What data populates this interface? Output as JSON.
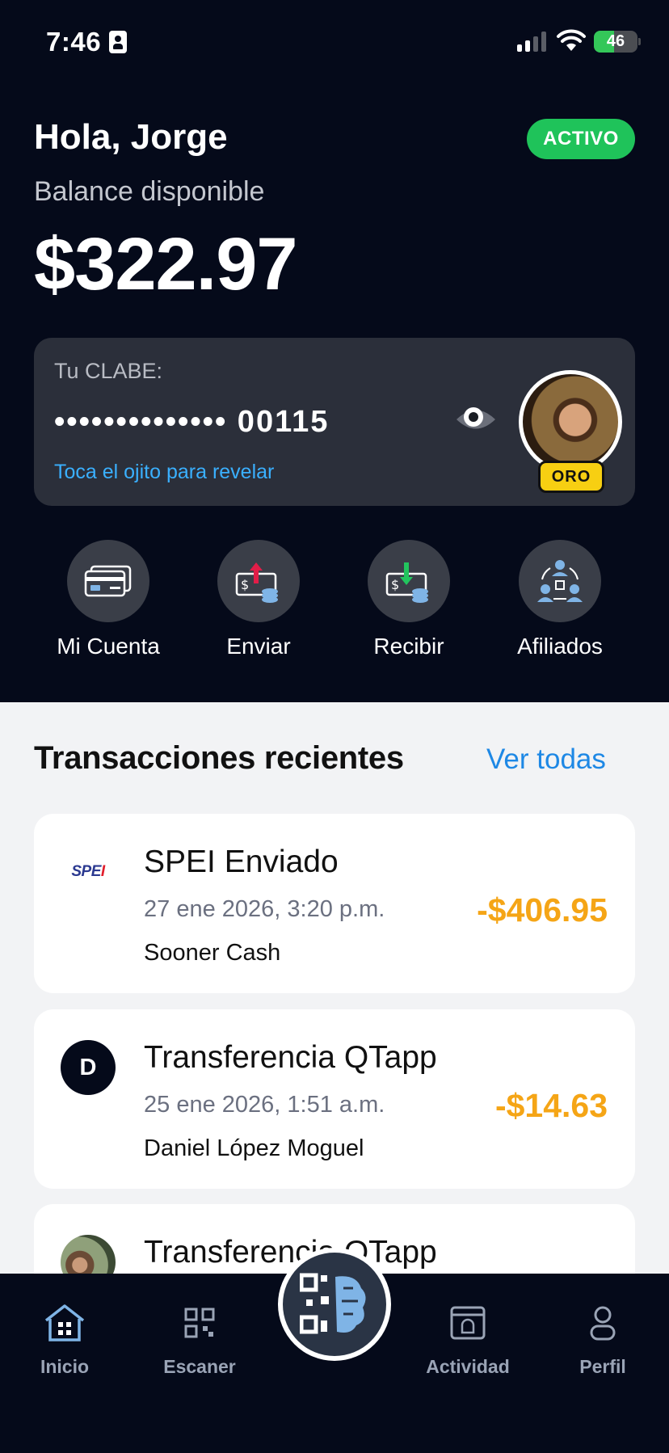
{
  "status_bar": {
    "time": "7:46",
    "battery": "46",
    "battery_percent": 46
  },
  "header": {
    "greeting": "Hola, Jorge",
    "status_badge": "ACTIVO",
    "balance_label": "Balance disponible",
    "balance": "$322.97"
  },
  "clabe": {
    "label": "Tu CLABE:",
    "masked_number": "•••••••••••••• 00115",
    "hint": "Toca el ojito para revelar",
    "tier": "ORO"
  },
  "actions": [
    {
      "label": "Mi Cuenta",
      "icon": "card-icon"
    },
    {
      "label": "Enviar",
      "icon": "send-money-icon"
    },
    {
      "label": "Recibir",
      "icon": "receive-money-icon"
    },
    {
      "label": "Afiliados",
      "icon": "affiliates-icon"
    }
  ],
  "transactions_section": {
    "title": "Transacciones recientes",
    "see_all": "Ver todas"
  },
  "transactions": [
    {
      "title": "SPEI Enviado",
      "date": "27 ene 2026, 3:20 p.m.",
      "counterparty": "Sooner Cash",
      "amount": "-$406.95",
      "icon_text": "SPE",
      "icon_accent": "I"
    },
    {
      "title": "Transferencia QTapp",
      "date": "25 ene 2026, 1:51 a.m.",
      "counterparty": "Daniel López Moguel",
      "amount": "-$14.63",
      "icon_text": "D"
    },
    {
      "title": "Transferencia QTapp"
    }
  ],
  "bottom_nav": [
    {
      "label": "Inicio",
      "icon": "home-icon",
      "active": true
    },
    {
      "label": "Escaner",
      "icon": "scanner-icon"
    },
    {
      "label": "Actividad",
      "icon": "activity-icon"
    },
    {
      "label": "Perfil",
      "icon": "profile-icon"
    }
  ],
  "colors": {
    "dark_bg": "#050a1a",
    "accent_green": "#1fc35a",
    "amount_orange": "#f5a516",
    "link_blue": "#1e88e5",
    "tier_yellow": "#f7cf12"
  }
}
